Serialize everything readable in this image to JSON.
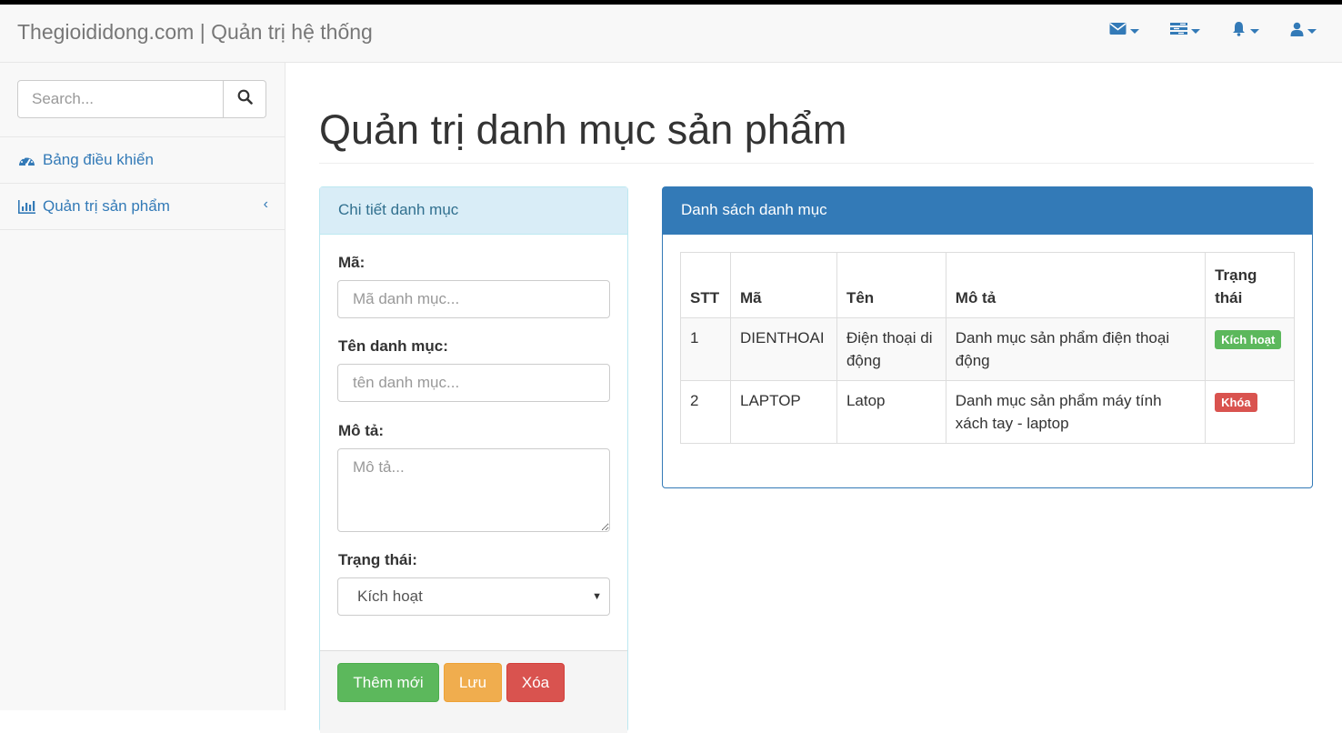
{
  "navbar": {
    "brand": "Thegioididong.com | Quản trị hệ thống",
    "icons": [
      "envelope-icon",
      "tasks-icon",
      "bell-icon",
      "user-icon"
    ]
  },
  "sidebar": {
    "search_placeholder": "Search...",
    "items": [
      {
        "label": "Bảng điều khiển",
        "icon": "dashboard-icon"
      },
      {
        "label": "Quản trị sản phẩm",
        "icon": "bar-chart-icon"
      }
    ]
  },
  "main": {
    "title": "Quản trị danh mục sản phẩm"
  },
  "detail_panel": {
    "heading": "Chi tiết danh mục",
    "code_label": "Mã:",
    "code_placeholder": "Mã danh mục...",
    "name_label": "Tên danh mục:",
    "name_placeholder": "tên danh mục...",
    "desc_label": "Mô tả:",
    "desc_placeholder": "Mô tả...",
    "status_label": "Trạng thái:",
    "status_value": "Kích hoạt",
    "buttons": {
      "add": "Thêm mới",
      "save": "Lưu",
      "delete": "Xóa"
    }
  },
  "list_panel": {
    "heading": "Danh sách danh mục",
    "columns": [
      "STT",
      "Mã",
      "Tên",
      "Mô tả",
      "Trạng thái"
    ],
    "rows": [
      {
        "stt": "1",
        "code": "DIENTHOAI",
        "name": "Điện thoại di động",
        "desc": "Danh mục sản phẩm điện thoại động",
        "status": "Kích hoạt"
      },
      {
        "stt": "2",
        "code": "LAPTOP",
        "name": "Latop",
        "desc": "Danh mục sản phẩm máy tính xách tay - laptop",
        "status": "Khóa"
      }
    ]
  },
  "colors": {
    "primary": "#337ab7",
    "success": "#5cb85c",
    "warning": "#f0ad4e",
    "danger": "#d9534f",
    "info_bg": "#d9edf7"
  }
}
